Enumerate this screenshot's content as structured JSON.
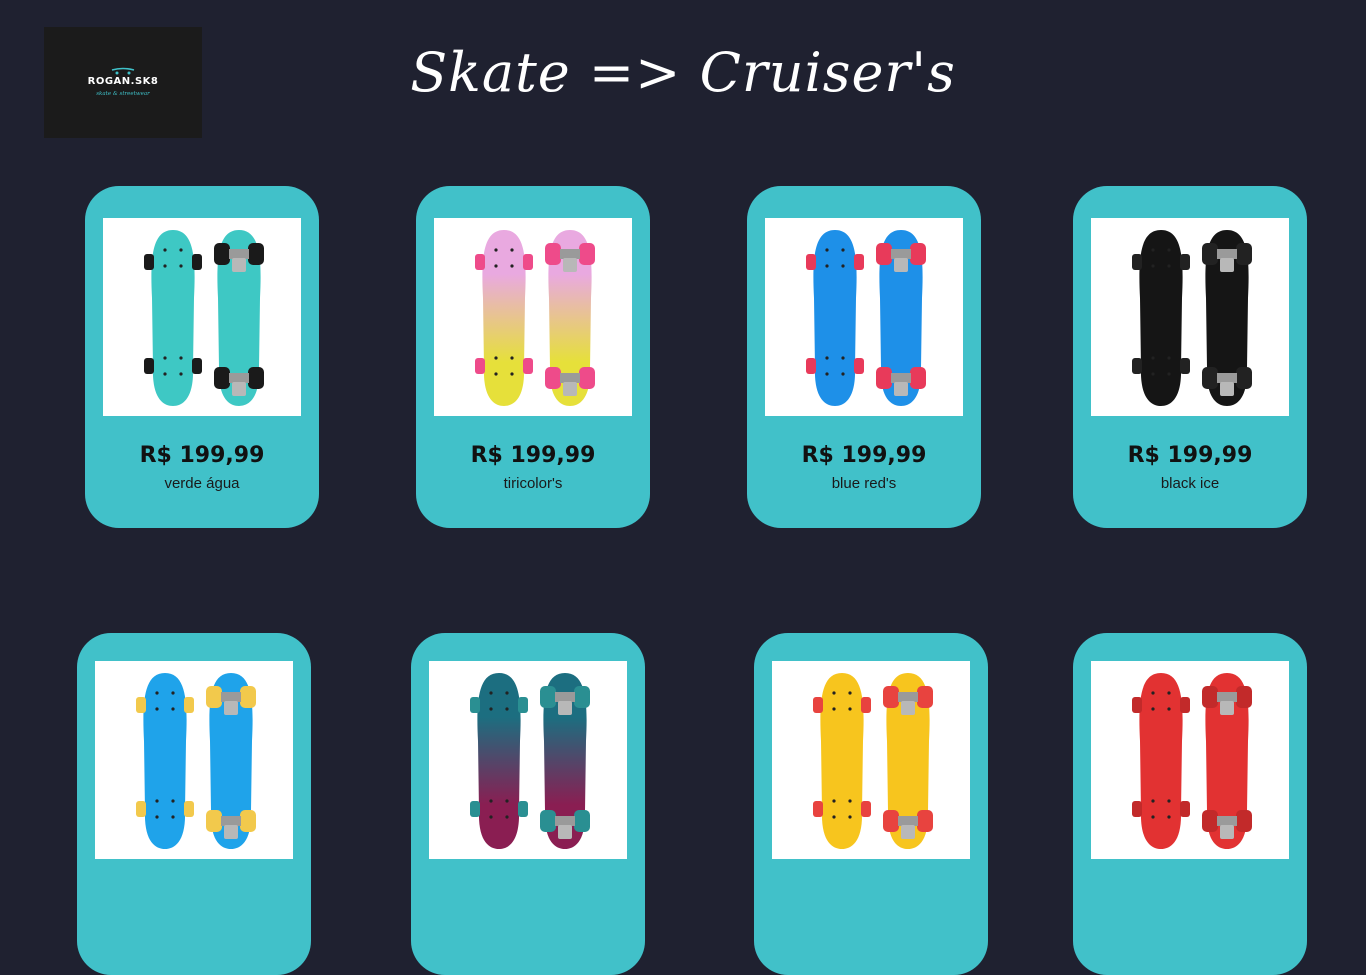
{
  "logo": {
    "name": "ROGAN.SK8",
    "tagline": "skate & streetwear"
  },
  "page_title": "Skate => Cruiser's",
  "products": [
    {
      "price": "R$ 199,99",
      "variant": "verde água",
      "deck_color": "#3ec8c4",
      "deck_color2": "#3ec8c4",
      "wheel_color": "#1a1a1a"
    },
    {
      "price": "R$ 199,99",
      "variant": "tiricolor's",
      "deck_color": "#e9a9e0",
      "deck_color2": "#e6e03a",
      "wheel_color": "#ee4b8a"
    },
    {
      "price": "R$ 199,99",
      "variant": "blue red's",
      "deck_color": "#1e90e8",
      "deck_color2": "#1e90e8",
      "wheel_color": "#e83a5a"
    },
    {
      "price": "R$ 199,99",
      "variant": "black ice",
      "deck_color": "#151515",
      "deck_color2": "#151515",
      "wheel_color": "#222222"
    },
    {
      "deck_color": "#1fa3ea",
      "deck_color2": "#1fa3ea",
      "wheel_color": "#f2c94c"
    },
    {
      "deck_color": "#1c6e80",
      "deck_color2": "#8a1e52",
      "wheel_color": "#2a8f92"
    },
    {
      "deck_color": "#f7c51e",
      "deck_color2": "#f7c51e",
      "wheel_color": "#e8433f"
    },
    {
      "deck_color": "#e23232",
      "deck_color2": "#e23232",
      "wheel_color": "#c22a2a"
    }
  ]
}
